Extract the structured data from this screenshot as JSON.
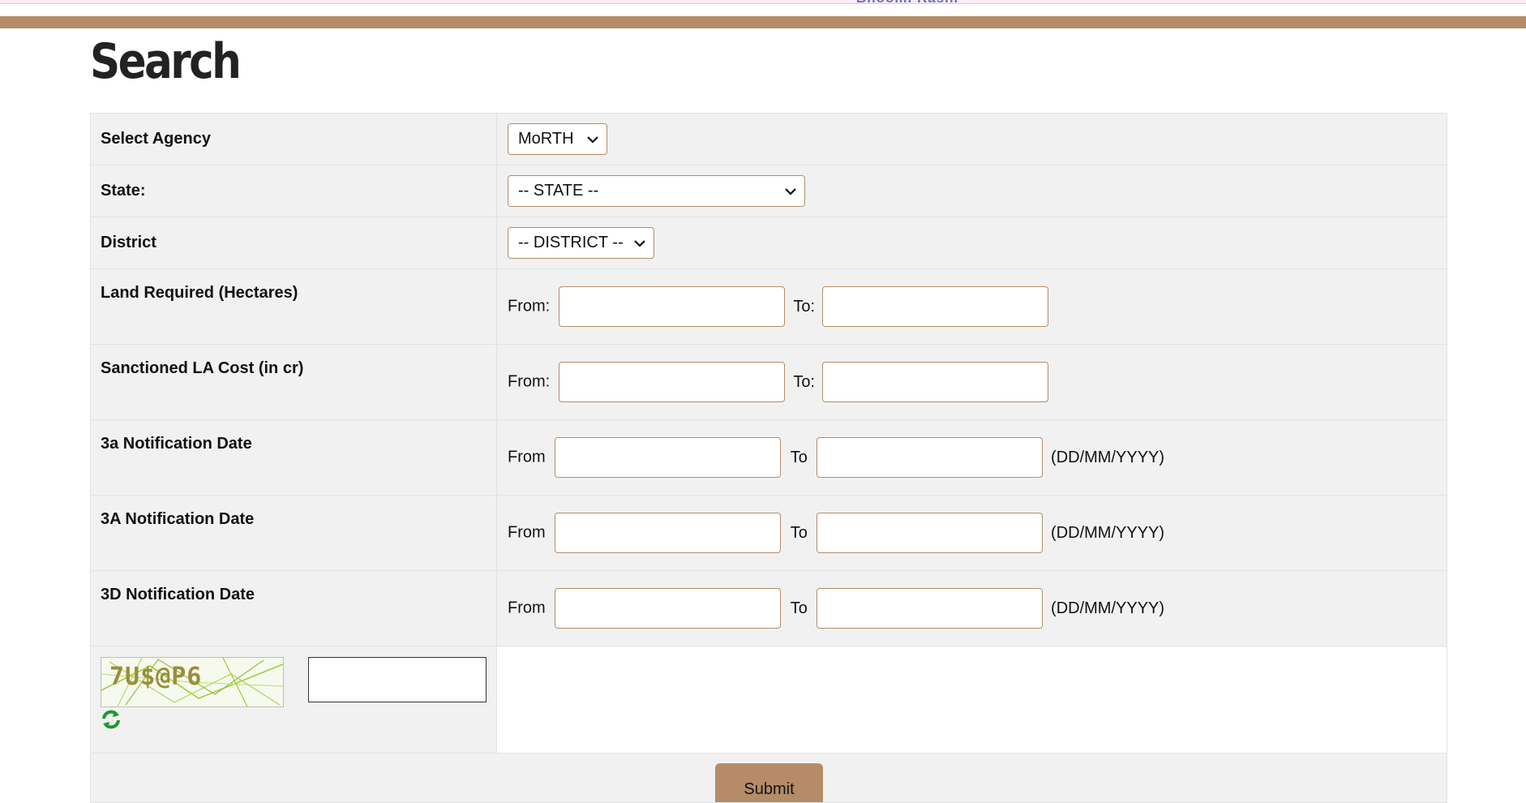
{
  "header": {
    "partial_text": "Bhoomi Rashi"
  },
  "page": {
    "title": "Search"
  },
  "form": {
    "agency": {
      "label": "Select Agency",
      "selected": "MoRTH"
    },
    "state": {
      "label": "State:",
      "selected": "-- STATE --"
    },
    "district": {
      "label": "District",
      "selected": "-- DISTRICT --"
    },
    "land_required": {
      "label": "Land Required (Hectares)",
      "from_label": "From:",
      "to_label": "To:",
      "from_value": "",
      "to_value": ""
    },
    "la_cost": {
      "label": "Sanctioned LA Cost (in cr)",
      "from_label": "From:",
      "to_label": "To:",
      "from_value": "",
      "to_value": ""
    },
    "notif_3a_lower": {
      "label": "3a Notification Date",
      "from_label": "From",
      "to_label": "To",
      "format_hint": "(DD/MM/YYYY)"
    },
    "notif_3A_upper": {
      "label": "3A Notification Date",
      "from_label": "From",
      "to_label": "To",
      "format_hint": "(DD/MM/YYYY)"
    },
    "notif_3D": {
      "label": "3D Notification Date",
      "from_label": "From",
      "to_label": "To",
      "format_hint": "(DD/MM/YYYY)"
    },
    "captcha": {
      "text": "7U$@P6",
      "input_value": ""
    },
    "submit_label": "Submit"
  },
  "colors": {
    "accent": "#b58c67",
    "row_bg": "#f1f1f1",
    "border": "#e2e2e2"
  },
  "icons": {
    "refresh": "refresh-icon",
    "dropdown": "chevron-down-icon"
  }
}
